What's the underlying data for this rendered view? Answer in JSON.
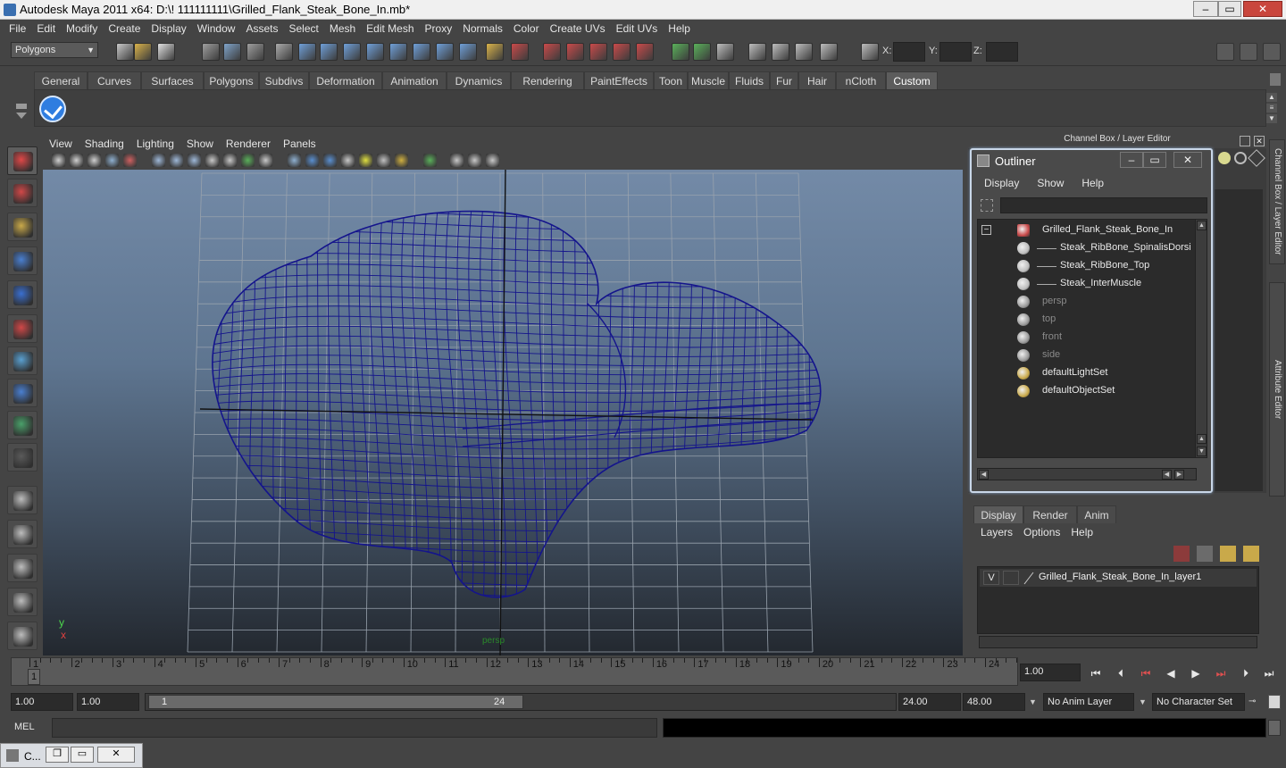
{
  "window": {
    "title": "Autodesk Maya 2011 x64: D:\\! 111111111\\Grilled_Flank_Steak_Bone_In.mb*",
    "min": "‒",
    "max": "▭",
    "close": "✕"
  },
  "menus": [
    "File",
    "Edit",
    "Modify",
    "Create",
    "Display",
    "Window",
    "Assets",
    "Select",
    "Mesh",
    "Edit Mesh",
    "Proxy",
    "Normals",
    "Color",
    "Create UVs",
    "Edit UVs",
    "Help"
  ],
  "statusline": {
    "mode": "Polygons",
    "x_label": "X:",
    "y_label": "Y:",
    "z_label": "Z:"
  },
  "shelf_tabs": [
    "General",
    "Curves",
    "Surfaces",
    "Polygons",
    "Subdivs",
    "Deformation",
    "Animation",
    "Dynamics",
    "Rendering",
    "PaintEffects",
    "Toon",
    "Muscle",
    "Fluids",
    "Fur",
    "Hair",
    "nCloth",
    "Custom"
  ],
  "shelf_active": "Custom",
  "viewport_menu": [
    "View",
    "Shading",
    "Lighting",
    "Show",
    "Renderer",
    "Panels"
  ],
  "channel_box_title": "Channel Box / Layer Editor",
  "side_tabs": [
    "Channel Box / Layer Editor",
    "Attribute Editor"
  ],
  "outliner": {
    "title": "Outliner",
    "menu": [
      "Display",
      "Show",
      "Help"
    ],
    "items": [
      {
        "name": "Grilled_Flank_Steak_Bone_In",
        "level": 0,
        "dim": false,
        "icon": "group-icon"
      },
      {
        "name": "Steak_RibBone_SpinalisDorsi",
        "level": 1,
        "dim": false,
        "icon": "mesh-icon"
      },
      {
        "name": "Steak_RibBone_Top",
        "level": 1,
        "dim": false,
        "icon": "mesh-icon"
      },
      {
        "name": "Steak_InterMuscle",
        "level": 1,
        "dim": false,
        "icon": "mesh-icon"
      },
      {
        "name": "persp",
        "level": 0,
        "dim": true,
        "icon": "camera-icon"
      },
      {
        "name": "top",
        "level": 0,
        "dim": true,
        "icon": "camera-icon"
      },
      {
        "name": "front",
        "level": 0,
        "dim": true,
        "icon": "camera-icon"
      },
      {
        "name": "side",
        "level": 0,
        "dim": true,
        "icon": "camera-icon"
      },
      {
        "name": "defaultLightSet",
        "level": 0,
        "dim": false,
        "icon": "set-icon"
      },
      {
        "name": "defaultObjectSet",
        "level": 0,
        "dim": false,
        "icon": "set-icon"
      }
    ]
  },
  "layer_editor": {
    "tabs": [
      "Display",
      "Render",
      "Anim"
    ],
    "menu": [
      "Layers",
      "Options",
      "Help"
    ],
    "layer": {
      "visible": "V",
      "name": "Grilled_Flank_Steak_Bone_In_layer1"
    }
  },
  "timeline": {
    "ticks": [
      1,
      2,
      3,
      4,
      5,
      6,
      7,
      8,
      9,
      10,
      11,
      12,
      13,
      14,
      15,
      16,
      17,
      18,
      19,
      20,
      21,
      22,
      23,
      24
    ],
    "current_marker": "1",
    "current_frame": "1.00"
  },
  "range": {
    "start": "1.00",
    "playback_start": "1.00",
    "thumb_start": "1",
    "thumb_end": "24",
    "playback_end": "24.00",
    "end": "48.00",
    "anim_layer": "No Anim Layer",
    "character_set": "No Character Set"
  },
  "command": {
    "label": "MEL"
  },
  "viewport_axis": {
    "x": "x",
    "y": "y"
  },
  "viewport_label": "persp",
  "minimized": {
    "title": "C..."
  },
  "colors": {
    "wire": "#14148c",
    "accent": "#3a6fb0",
    "close": "#c9463d"
  }
}
